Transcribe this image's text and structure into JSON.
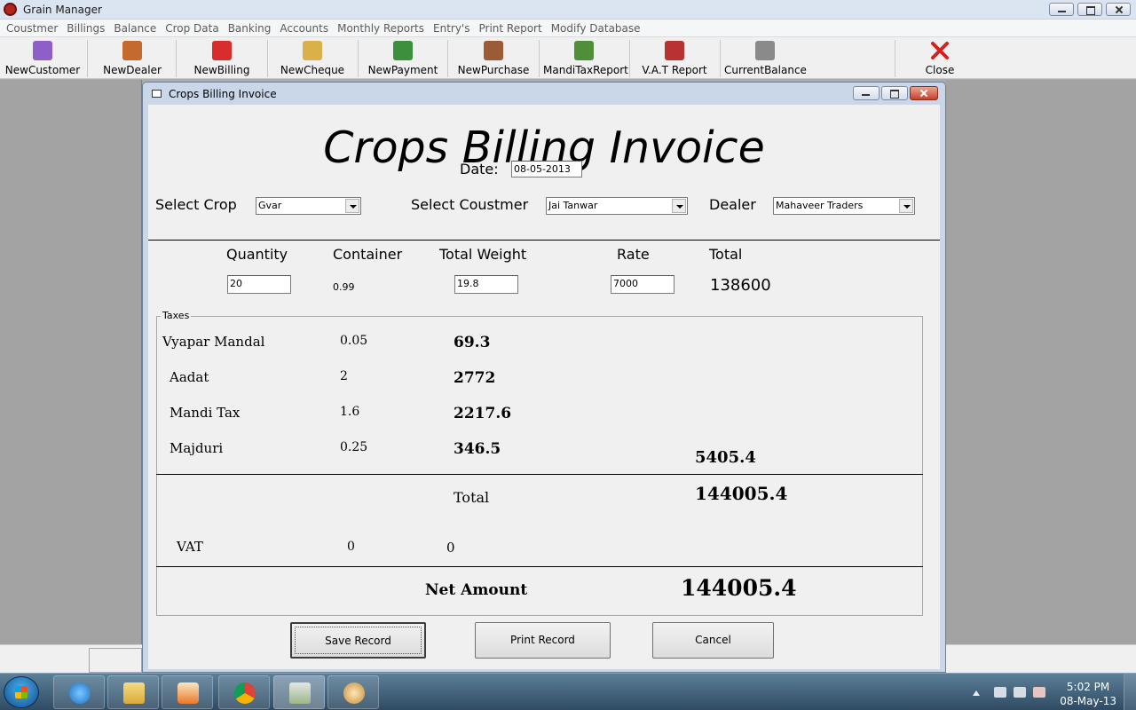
{
  "app": {
    "title": "Grain Manager",
    "menu": [
      "Coustmer",
      "Billings",
      "Balance",
      "Crop Data",
      "Banking",
      "Accounts",
      "Monthly Reports",
      "Entry's",
      "Print Report",
      "Modify Database"
    ],
    "toolbar": [
      {
        "label": "NewCustomer",
        "icon": "customer-icon",
        "color": "#8e5fc9"
      },
      {
        "label": "NewDealer",
        "icon": "dealer-icon",
        "color": "#c46a2f"
      },
      {
        "label": "NewBilling",
        "icon": "billing-icon",
        "color": "#d92d2d"
      },
      {
        "label": "NewCheque",
        "icon": "cheque-icon",
        "color": "#d9b04a"
      },
      {
        "label": "NewPayment",
        "icon": "payment-icon",
        "color": "#3d8f3d"
      },
      {
        "label": "NewPurchase",
        "icon": "purchase-icon",
        "color": "#9a5b36"
      },
      {
        "label": "MandiTaxReport",
        "icon": "mandi-tax-report-icon",
        "color": "#4f8f3a"
      },
      {
        "label": "V.A.T Report",
        "icon": "vat-report-icon",
        "color": "#b83232"
      },
      {
        "label": "CurrentBalance",
        "icon": "current-balance-icon",
        "color": "#8a8a8a"
      },
      {
        "label": "Close",
        "icon": "close-icon",
        "color": "#d42020"
      }
    ]
  },
  "dialog": {
    "title": "Crops Billing Invoice",
    "heading": "Crops Billing Invoice",
    "date_label": "Date:",
    "date_value": "08-05-2013",
    "select_crop_label": "Select Crop",
    "select_crop_value": "Gvar",
    "select_customer_label": "Select Coustmer",
    "select_customer_value": "Jai Tanwar",
    "dealer_label": "Dealer",
    "dealer_value": "Mahaveer Traders",
    "columns": {
      "quantity": "Quantity",
      "container": "Container",
      "total_weight": "Total Weight",
      "rate": "Rate",
      "total": "Total"
    },
    "values": {
      "quantity": "20",
      "container": "0.99",
      "total_weight": "19.8",
      "rate": "7000",
      "total": "138600"
    },
    "taxes_legend": "Taxes",
    "taxes": [
      {
        "name": "Vyapar Mandal",
        "rate": "0.05",
        "amount": "69.3"
      },
      {
        "name": "Aadat",
        "rate": "2",
        "amount": "2772"
      },
      {
        "name": "Mandi Tax",
        "rate": "1.6",
        "amount": "2217.6"
      },
      {
        "name": "Majduri",
        "rate": "0.25",
        "amount": "346.5"
      }
    ],
    "tax_total": "5405.4",
    "total_label": "Total",
    "total_value": "144005.4",
    "vat_label": "VAT",
    "vat_rate": "0",
    "vat_amount": "0",
    "net_amount_label": "Net Amount",
    "net_amount_value": "144005.4",
    "buttons": {
      "save": "Save Record",
      "print": "Print Record",
      "cancel": "Cancel"
    }
  },
  "taskbar": {
    "time": "5:02 PM",
    "date": "08-May-13"
  }
}
